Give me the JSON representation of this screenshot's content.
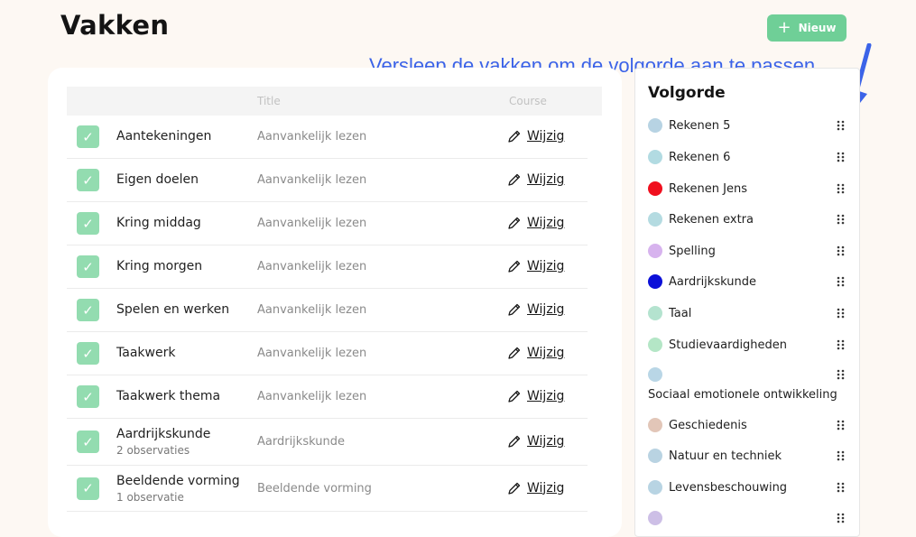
{
  "page": {
    "title": "Vakken"
  },
  "header": {
    "new_label": "Nieuw"
  },
  "hint": "Versleep de vakken om de volgorde aan te passen",
  "table": {
    "columns": {
      "title": "Title",
      "course": "Course"
    },
    "rows": [
      {
        "name": "Aantekeningen",
        "sub": "",
        "course": "Aanvankelijk lezen",
        "edit": "Wijzig"
      },
      {
        "name": "Eigen doelen",
        "sub": "",
        "course": "Aanvankelijk lezen",
        "edit": "Wijzig"
      },
      {
        "name": "Kring middag",
        "sub": "",
        "course": "Aanvankelijk lezen",
        "edit": "Wijzig"
      },
      {
        "name": "Kring morgen",
        "sub": "",
        "course": "Aanvankelijk lezen",
        "edit": "Wijzig"
      },
      {
        "name": "Spelen en werken",
        "sub": "",
        "course": "Aanvankelijk lezen",
        "edit": "Wijzig"
      },
      {
        "name": "Taakwerk",
        "sub": "",
        "course": "Aanvankelijk lezen",
        "edit": "Wijzig"
      },
      {
        "name": "Taakwerk thema",
        "sub": "",
        "course": "Aanvankelijk lezen",
        "edit": "Wijzig"
      },
      {
        "name": "Aardrijkskunde",
        "sub": "2 observaties",
        "course": "Aardrijkskunde",
        "edit": "Wijzig"
      },
      {
        "name": "Beeldende vorming",
        "sub": "1 observatie",
        "course": "Beeldende vorming",
        "edit": "Wijzig"
      }
    ]
  },
  "order": {
    "title": "Volgorde",
    "items": [
      {
        "label": "Rekenen 5",
        "color": "#b7d3e3"
      },
      {
        "label": "Rekenen 6",
        "color": "#b2dbe2"
      },
      {
        "label": "Rekenen Jens",
        "color": "#f00f1e"
      },
      {
        "label": "Rekenen extra",
        "color": "#b4dbe1"
      },
      {
        "label": "Spelling",
        "color": "#d7b3ee"
      },
      {
        "label": "Aardrijkskunde",
        "color": "#0c10d8"
      },
      {
        "label": "Taal",
        "color": "#b4e3cf"
      },
      {
        "label": "Studievaardigheden",
        "color": "#b4e6c6"
      },
      {
        "label": "Sociaal emotionele ontwikkeling",
        "color": "#b9d6e6"
      },
      {
        "label": "Geschiedenis",
        "color": "#e2c6b8"
      },
      {
        "label": "Natuur en techniek",
        "color": "#b9d3e2"
      },
      {
        "label": "Levensbeschouwing",
        "color": "#b8d4e3"
      },
      {
        "label": "",
        "color": "#cdbfe6"
      }
    ]
  },
  "icons": {
    "check": "check-icon",
    "edit": "pencil-icon",
    "drag": "drag-handle-icon",
    "add": "plus-icon"
  }
}
